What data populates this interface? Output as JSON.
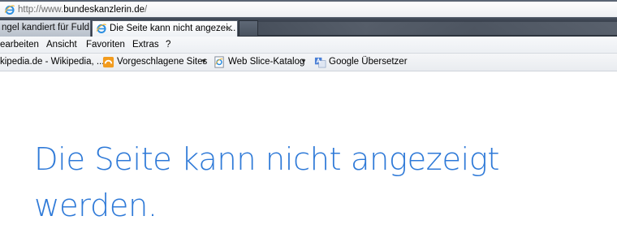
{
  "address_bar": {
    "url_prefix": "http://www.",
    "url_host": "bundeskanzlerin.de",
    "url_suffix": "/"
  },
  "tabs": [
    {
      "label": "ngel kandiert für Fuld...",
      "active": false
    },
    {
      "label": "Die Seite kann nicht angezei...",
      "active": true,
      "close_glyph": "✕"
    }
  ],
  "menu": [
    "earbeiten",
    "Ansicht",
    "Favoriten",
    "Extras",
    "?"
  ],
  "favorites": [
    {
      "label": "kipedia.de - Wikipedia, ...",
      "icon": null
    },
    {
      "label": "Vorgeschlagene Sites",
      "icon": "suggested-sites-icon",
      "dropdown": true
    },
    {
      "label": "Web Slice-Katalog",
      "icon": "web-slice-icon",
      "dropdown": true
    },
    {
      "label": "Google Übersetzer",
      "icon": "google-translate-icon"
    }
  ],
  "dropdown_glyph": "▼",
  "content": {
    "heading": "Die Seite kann nicht angezeigt werden."
  },
  "colors": {
    "heading": "#2f7ad8",
    "ie_logo": "#2a8ee0",
    "suggested_sites": "#f29b1d"
  }
}
